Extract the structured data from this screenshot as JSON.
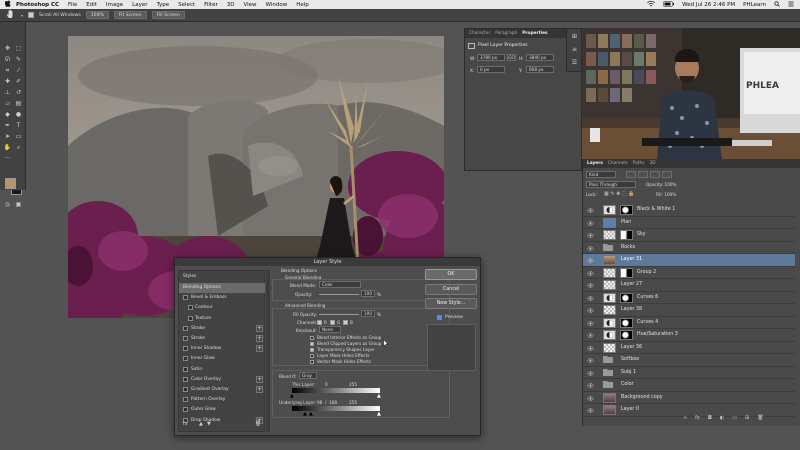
{
  "menubar": {
    "apple": "",
    "items": [
      "Photoshop CC",
      "File",
      "Edit",
      "Image",
      "Layer",
      "Type",
      "Select",
      "Filter",
      "3D",
      "View",
      "Window",
      "Help"
    ],
    "clock": "Wed Jul 26  2:46 PM",
    "user": "PHLearn"
  },
  "options_bar": {
    "scroll_all_windows": "Scroll All Windows",
    "zoom": "100%",
    "fit_screen": "Fit Screen",
    "fill_screen": "Fill Screen"
  },
  "properties_panel": {
    "tabs": [
      "Character",
      "Paragraph",
      "Properties"
    ],
    "title": "Pixel Layer Properties",
    "w_label": "W:",
    "w_value": "3780 px",
    "h_label": "H:",
    "h_value": "3840 px",
    "link_label": "GO",
    "x_label": "X:",
    "x_value": "0 px",
    "y_label": "Y:",
    "y_value": "608 px"
  },
  "video_overlay": {
    "logo": "PHLEA"
  },
  "layers_panel": {
    "tabs": [
      "Layers",
      "Channels",
      "Paths",
      "3D"
    ],
    "kind": "Kind",
    "blend_mode": "Pass Through",
    "opacity": "Opacity: 100%",
    "lock_label": "Lock:",
    "fill_label": "Fill: 100%",
    "layers": [
      {
        "name": "Black & White 1",
        "type": "adjustment"
      },
      {
        "name": "Plan",
        "type": "color"
      },
      {
        "name": "Sky",
        "type": "mask"
      },
      {
        "name": "Rocks",
        "type": "group"
      },
      {
        "name": "Layer 31",
        "type": "layer",
        "selected": true
      },
      {
        "name": "Group 2",
        "type": "mask"
      },
      {
        "name": "Layer 27",
        "type": "checker"
      },
      {
        "name": "Curves 6",
        "type": "adjustment"
      },
      {
        "name": "Layer 38",
        "type": "checker"
      },
      {
        "name": "Curves 4",
        "type": "adjustment"
      },
      {
        "name": "Hue/Saturation 3",
        "type": "adjustment"
      },
      {
        "name": "Layer 36",
        "type": "checker"
      },
      {
        "name": "Softbox",
        "type": "group"
      },
      {
        "name": "Subj 1",
        "type": "group"
      },
      {
        "name": "Color",
        "type": "group"
      },
      {
        "name": "Background copy",
        "type": "photo"
      },
      {
        "name": "Layer 0",
        "type": "photo"
      }
    ],
    "footer_icons": [
      "link-icon",
      "fx-icon",
      "mask-icon",
      "adjustment-icon",
      "folder-icon",
      "new-layer-icon",
      "trash-icon"
    ]
  },
  "layer_style": {
    "title": "Layer Style",
    "styles_header": "Styles",
    "styles": [
      {
        "label": "Blending Options",
        "checkbox": false,
        "plus": false,
        "selected": true
      },
      {
        "label": "Bevel & Emboss",
        "checkbox": true,
        "plus": false
      },
      {
        "label": "Contour",
        "checkbox": true,
        "plus": false,
        "indent": true
      },
      {
        "label": "Texture",
        "checkbox": true,
        "plus": false,
        "indent": true
      },
      {
        "label": "Stroke",
        "checkbox": true,
        "plus": true
      },
      {
        "label": "Stroke",
        "checkbox": true,
        "plus": true
      },
      {
        "label": "Inner Shadow",
        "checkbox": true,
        "plus": true
      },
      {
        "label": "Inner Glow",
        "checkbox": true,
        "plus": false
      },
      {
        "label": "Satin",
        "checkbox": true,
        "plus": false
      },
      {
        "label": "Color Overlay",
        "checkbox": true,
        "plus": true
      },
      {
        "label": "Gradient Overlay",
        "checkbox": true,
        "plus": true
      },
      {
        "label": "Pattern Overlay",
        "checkbox": true,
        "plus": false
      },
      {
        "label": "Outer Glow",
        "checkbox": true,
        "plus": false
      },
      {
        "label": "Drop Shadow",
        "checkbox": true,
        "plus": true
      }
    ],
    "fx_label": "fx",
    "blending": {
      "header": "Blending Options",
      "general_header": "General Blending",
      "blend_mode_label": "Blend Mode:",
      "blend_mode_value": "Color",
      "opacity_label": "Opacity:",
      "opacity_value": "100",
      "percent": "%",
      "advanced_header": "Advanced Blending",
      "fill_label": "Fill Opacity:",
      "fill_value": "100",
      "channels_label": "Channels:",
      "channel_r": "R",
      "channel_g": "G",
      "channel_b": "B",
      "knockout_label": "Knockout:",
      "knockout_value": "None",
      "options": [
        {
          "label": "Blend Interior Effects as Group",
          "checked": false
        },
        {
          "label": "Blend Clipped Layers as Group",
          "checked": true
        },
        {
          "label": "Transparency Shapes Layer",
          "checked": true
        },
        {
          "label": "Layer Mask Hides Effects",
          "checked": false
        },
        {
          "label": "Vector Mask Hides Effects",
          "checked": false
        }
      ],
      "blend_if_label": "Blend If:",
      "blend_if_value": "Gray",
      "this_layer_label": "This Layer:",
      "this_layer_min": "0",
      "this_layer_max": "255",
      "underlying_label": "Underlying Layer:",
      "underlying_a": "98",
      "underlying_sep": "/",
      "underlying_b": "168",
      "underlying_max": "255"
    },
    "buttons": {
      "ok": "OK",
      "cancel": "Cancel",
      "new_style": "New Style...",
      "preview": "Preview",
      "preview_checked": true
    }
  },
  "colors": {
    "foreground": "#b9926e",
    "background": "#1a1a1a",
    "selection": "#5e7a9b"
  }
}
